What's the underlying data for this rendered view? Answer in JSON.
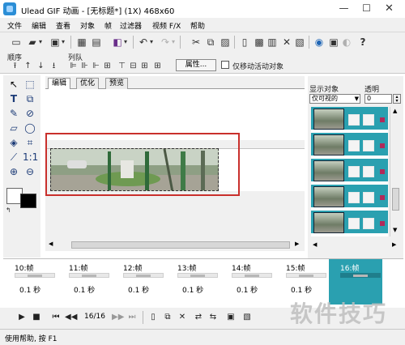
{
  "window": {
    "title": "Ulead GIF 动画 - [无标题*] (1X) 468x60"
  },
  "menu": [
    "文件",
    "编辑",
    "查看",
    "对象",
    "帧",
    "过滤器",
    "视频 F/X",
    "帮助"
  ],
  "orderbar": {
    "order_label": "顺序",
    "queue_label": "列队",
    "properties_button": "属性...",
    "move_active_only_label": "仅移动活动对象"
  },
  "editor": {
    "tabs": [
      "编辑",
      "优化",
      "预览"
    ],
    "active_tab": "编辑"
  },
  "panel": {
    "show_objects_label": "显示对象",
    "show_objects_value": "仅可视的",
    "opacity_label": "透明",
    "opacity_value": "0",
    "layer_count": 5
  },
  "frames": [
    {
      "label": "10:帧",
      "delay": "0.1 秒"
    },
    {
      "label": "11:帧",
      "delay": "0.1 秒"
    },
    {
      "label": "12:帧",
      "delay": "0.1 秒"
    },
    {
      "label": "13:帧",
      "delay": "0.1 秒"
    },
    {
      "label": "14:帧",
      "delay": "0.1 秒"
    },
    {
      "label": "15:帧",
      "delay": "0.1 秒"
    },
    {
      "label": "16:帧",
      "delay": ""
    }
  ],
  "playback": {
    "frame_counter": "16/16"
  },
  "statusbar": {
    "text": "使用帮助, 按 F1"
  },
  "watermark": "软件技巧",
  "colors": {
    "accent": "#2aa0b0",
    "selection": "#c9302c",
    "foreground_swatch": "#ffffff",
    "background_swatch": "#000000"
  }
}
